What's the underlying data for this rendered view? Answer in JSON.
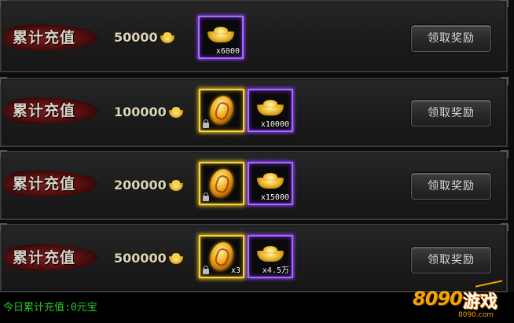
{
  "rows": [
    {
      "ribbon": "累计充值",
      "amount": "50000",
      "rewards": [
        {
          "type": "ingot",
          "frame": "purple",
          "qty": "x6000",
          "locked": false
        }
      ],
      "button": "领取奖励"
    },
    {
      "ribbon": "累计充值",
      "amount": "100000",
      "rewards": [
        {
          "type": "egg",
          "frame": "gold",
          "qty": "",
          "locked": true
        },
        {
          "type": "ingot",
          "frame": "purple",
          "qty": "x10000",
          "locked": false
        }
      ],
      "button": "领取奖励"
    },
    {
      "ribbon": "累计充值",
      "amount": "200000",
      "rewards": [
        {
          "type": "egg",
          "frame": "gold",
          "qty": "",
          "locked": true
        },
        {
          "type": "ingot",
          "frame": "purple",
          "qty": "x15000",
          "locked": false
        }
      ],
      "button": "领取奖励"
    },
    {
      "ribbon": "累计充值",
      "amount": "500000",
      "rewards": [
        {
          "type": "egg",
          "frame": "gold",
          "qty": "x3",
          "locked": true
        },
        {
          "type": "ingot",
          "frame": "purple",
          "qty": "x4.5万",
          "locked": false
        }
      ],
      "button": "领取奖励"
    }
  ],
  "footer": {
    "today_total": "今日累计充值:0元宝"
  },
  "watermark": {
    "brand_num": "8090",
    "brand_cn": "游戏",
    "url": "8090.com"
  },
  "colors": {
    "purple_frame": "#a56bff",
    "gold_frame": "#f6d63f",
    "footer_text": "#2bc82b"
  },
  "icons": {
    "ingot": "gold-ingot-icon",
    "egg": "golden-egg-icon",
    "lock": "lock-icon"
  }
}
